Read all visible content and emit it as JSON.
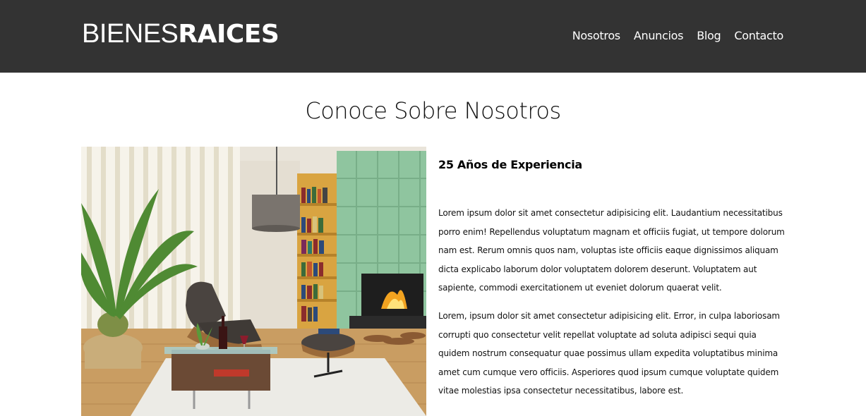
{
  "header": {
    "logo_light": "BIENES",
    "logo_bold": "RAICES",
    "nav": [
      "Nosotros",
      "Anuncios",
      "Blog",
      "Contacto"
    ]
  },
  "section": {
    "title": "Conoce Sobre Nosotros"
  },
  "about": {
    "heading": "25 Años de Experiencia",
    "paragraphs": [
      "Lorem ipsum dolor sit amet consectetur adipisicing elit. Laudantium necessitatibus porro enim! Repellendus voluptatum magnam et officiis fugiat, ut tempore dolorum nam est. Rerum omnis quos nam, voluptas iste officiis eaque dignissimos aliquam dicta explicabo laborum dolor voluptatem dolorem deserunt. Voluptatem aut sapiente, commodi exercitationem ut eveniet dolorum quaerat velit.",
      "Lorem, ipsum dolor sit amet consectetur adipisicing elit. Error, in culpa laboriosam corrupti quo consectetur velit repellat voluptate ad soluta adipisci sequi quia quidem nostrum consequatur quae possimus ullam expedita voluptatibus minima amet cum cumque vero officiis. Asperiores quod ipsum cumque voluptate quidem vitae molestias ipsa consectetur necessitatibus, labore est."
    ]
  },
  "colors": {
    "header_bg": "#333333",
    "text": "#000000"
  }
}
